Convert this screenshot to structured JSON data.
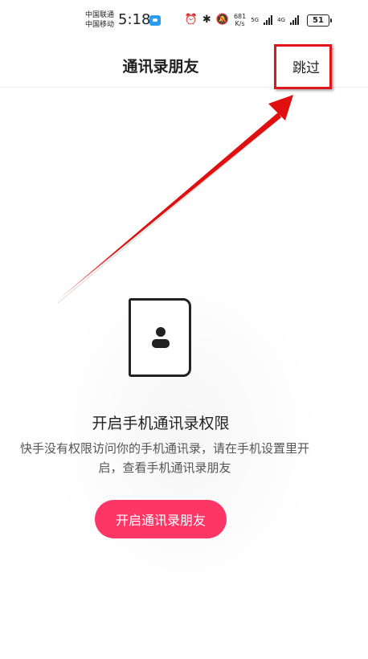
{
  "status_bar": {
    "carrier_1": "中国联通",
    "carrier_2": "中国移动",
    "time": "5:18",
    "net_speed_value": "681",
    "net_speed_unit": "K/s",
    "network_1": "5G",
    "network_2": "4G",
    "battery": "51"
  },
  "header": {
    "title": "通讯录朋友",
    "skip_label": "跳过"
  },
  "main": {
    "permission_title": "开启手机通讯录权限",
    "permission_desc": "快手没有权限访问你的手机通讯录，请在手机设置里开启，查看手机通讯录朋友",
    "open_button_label": "开启通讯录朋友"
  },
  "colors": {
    "accent": "#fe3666",
    "annotation_red": "#e0141b"
  }
}
